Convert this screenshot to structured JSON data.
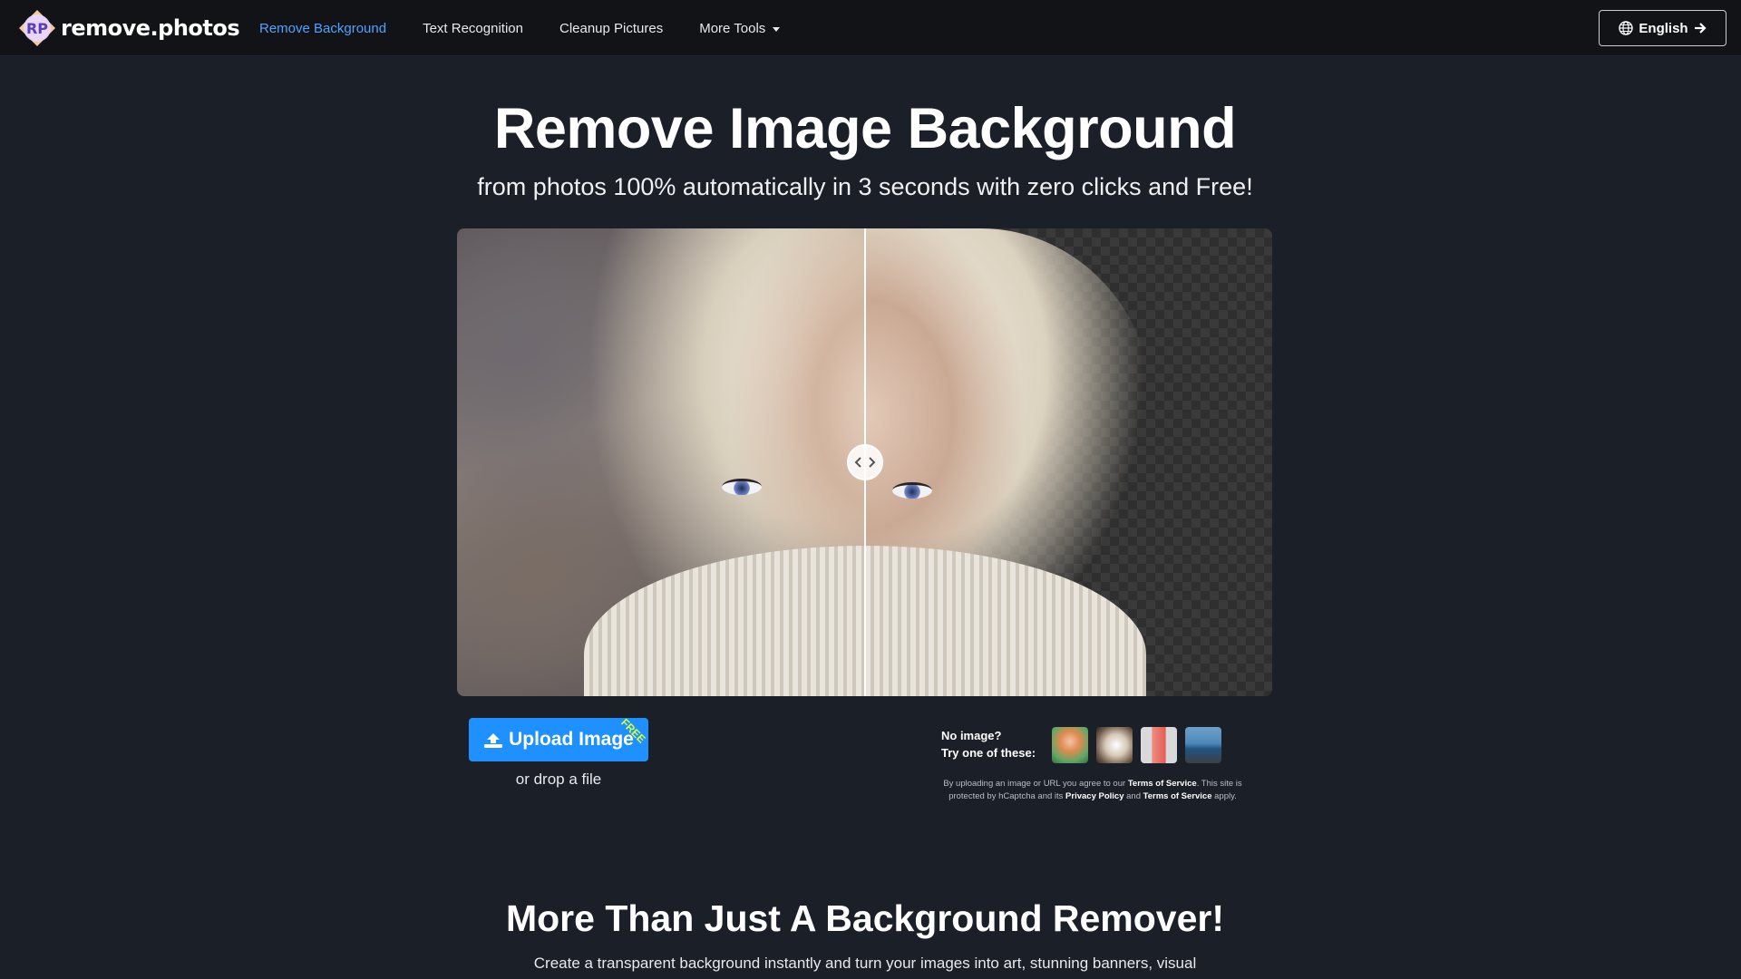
{
  "brand": {
    "name": "remove.photos",
    "logo_initials": "RP"
  },
  "nav": {
    "links": [
      {
        "label": "Remove Background",
        "active": true
      },
      {
        "label": "Text Recognition",
        "active": false
      },
      {
        "label": "Cleanup Pictures",
        "active": false
      },
      {
        "label": "More Tools",
        "active": false,
        "dropdown": true
      }
    ],
    "language": {
      "label": "English",
      "icon": "globe-icon",
      "arrow_icon": "arrow-right-icon"
    }
  },
  "hero": {
    "title": "Remove Image Background",
    "subtitle": "from photos 100% automatically in 3 seconds with zero clicks and Free!"
  },
  "upload": {
    "button_label": "Upload Image",
    "badge": "FREE",
    "drop_text": "or drop a file",
    "icon": "upload-cloud-icon"
  },
  "samples": {
    "label_line1": "No image?",
    "label_line2": "Try one of these:",
    "items": [
      "sample-woman",
      "sample-dog",
      "sample-phone",
      "sample-car"
    ]
  },
  "legal": {
    "part1": "By uploading an image or URL you agree to our ",
    "tos1": "Terms of Service",
    "part2": ". This site is protected by hCaptcha and its ",
    "privacy": "Privacy Policy",
    "part3": " and ",
    "tos2": "Terms of Service",
    "part4": " apply."
  },
  "section": {
    "title": "More Than Just A Background Remover!",
    "subtitle": "Create a transparent background instantly and turn your images into art, stunning banners, visual"
  },
  "colors": {
    "accent": "#1e90ff",
    "nav_active": "#4fa3ff",
    "badge": "#d8ff3a",
    "page_bg": "#1b1f27",
    "nav_bg": "#111317"
  }
}
